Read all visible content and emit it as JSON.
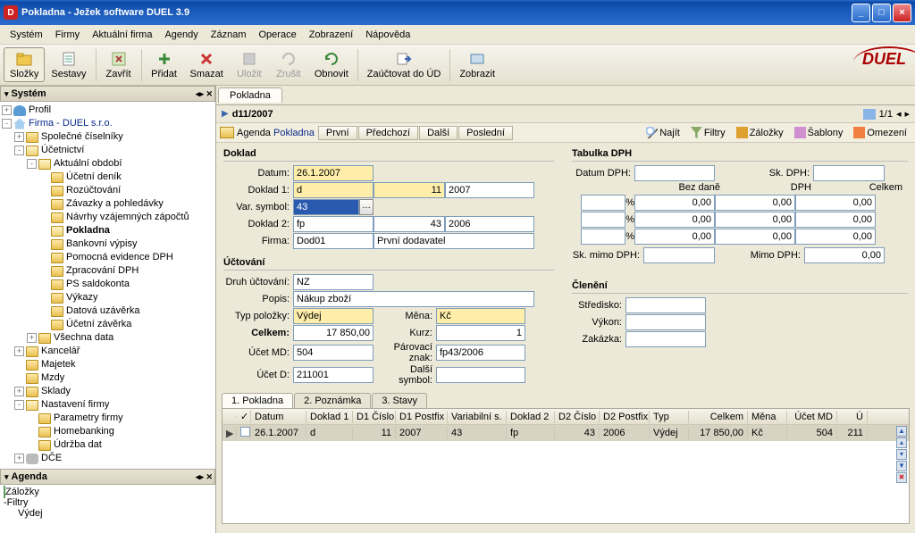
{
  "titlebar": {
    "title": "Pokladna - Ježek software DUEL 3.9",
    "icon_letter": "D"
  },
  "menu": [
    "Systém",
    "Firmy",
    "Aktuální firma",
    "Agendy",
    "Záznam",
    "Operace",
    "Zobrazení",
    "Nápověda"
  ],
  "toolbar": {
    "items": [
      {
        "label": "Složky",
        "active": true
      },
      {
        "label": "Sestavy"
      },
      {
        "sep": true
      },
      {
        "label": "Zavřít"
      },
      {
        "sep": true
      },
      {
        "label": "Přidat"
      },
      {
        "label": "Smazat"
      },
      {
        "label": "Uložit",
        "disabled": true
      },
      {
        "label": "Zrušit",
        "disabled": true
      },
      {
        "label": "Obnovit"
      },
      {
        "sep": true
      },
      {
        "label": "Zaúčtovat do ÚD"
      },
      {
        "sep": true
      },
      {
        "label": "Zobrazit"
      }
    ],
    "logo": "DUEL"
  },
  "left": {
    "system_title": "Systém",
    "agenda_title": "Agenda",
    "tree": {
      "profil": "Profil",
      "firma": "Firma - DUEL s.r.o.",
      "uc": {
        "spolecne": "Společné číselníky",
        "ucetnictvi": "Účetnictví",
        "aktualni": "Aktuální období",
        "leaves": [
          "Účetní deník",
          "Rozúčtování",
          "Závazky a pohledávky",
          "Návrhy vzájemných zápočtů",
          "Pokladna",
          "Bankovní výpisy",
          "Pomocná evidence DPH",
          "Zpracování DPH",
          "PS saldokonta",
          "Výkazy",
          "Datová uzávěrka",
          "Účetní závěrka"
        ],
        "vsechna": "Všechna data"
      },
      "kancelar": "Kancelář",
      "majetek": "Majetek",
      "mzdy": "Mzdy",
      "sklady": "Sklady",
      "nastaveni": "Nastavení firmy",
      "parametry": "Parametry firmy",
      "homebanking": "Homebanking",
      "udrzba": "Údržba dat",
      "dce": "DČE",
      "zalozky": "Záložky",
      "filtry": "Filtry",
      "vydej": "Výdej"
    }
  },
  "content": {
    "tab": "Pokladna",
    "record_id": "d11/2007",
    "pager": "1/1",
    "subnav": {
      "agenda": "Agenda",
      "pokladna": "Pokladna",
      "first": "První",
      "prev": "Předchozí",
      "next": "Další",
      "last": "Poslední"
    },
    "tools": {
      "find": "Najít",
      "filter": "Filtry",
      "bookmark": "Záložky",
      "templates": "Šablony",
      "limit": "Omezení"
    },
    "doklad": {
      "title": "Doklad",
      "datum_l": "Datum:",
      "datum": "26.1.2007",
      "doklad1_l": "Doklad 1:",
      "doklad1_a": "d",
      "doklad1_b": "11",
      "doklad1_c": "2007",
      "vs_l": "Var. symbol:",
      "vs": "43",
      "doklad2_l": "Doklad 2:",
      "doklad2_a": "fp",
      "doklad2_b": "43",
      "doklad2_c": "2006",
      "firma_l": "Firma:",
      "firma_code": "Dod01",
      "firma_name": "První dodavatel"
    },
    "uctovani": {
      "title": "Účtování",
      "druh_l": "Druh účtování:",
      "druh": "NZ",
      "popis_l": "Popis:",
      "popis": "Nákup zboží",
      "typ_l": "Typ položky:",
      "typ": "Výdej",
      "mena_l": "Měna:",
      "mena": "Kč",
      "celkem_l": "Celkem:",
      "celkem": "17 850,00",
      "kurz_l": "Kurz:",
      "kurz": "1",
      "md_l": "Účet MD:",
      "md": "504",
      "par_l": "Párovací znak:",
      "par": "fp43/2006",
      "d_l": "Účet D:",
      "d": "211001",
      "dalsi_l": "Další symbol:",
      "dalsi": ""
    },
    "dph": {
      "title": "Tabulka DPH",
      "datum_l": "Datum DPH:",
      "sk_l": "Sk. DPH:",
      "head": {
        "bez": "Bez daně",
        "dph": "DPH",
        "cel": "Celkem"
      },
      "row_vals": [
        "0,00",
        "0,00",
        "0,00"
      ],
      "pct": "%",
      "mimo_l": "Sk. mimo DPH:",
      "mimodph_l": "Mimo DPH:",
      "mimodph": "0,00"
    },
    "clen": {
      "title": "Členění",
      "str_l": "Středisko:",
      "vyk_l": "Výkon:",
      "zak_l": "Zakázka:"
    },
    "grid": {
      "tabs": [
        "1. Pokladna",
        "2. Poznámka",
        "3. Stavy"
      ],
      "cols": [
        "Datum",
        "Doklad 1",
        "D1 Číslo",
        "D1 Postfix",
        "Variabilní s.",
        "Doklad 2",
        "D2 Číslo",
        "D2 Postfix",
        "Typ",
        "Celkem",
        "Měna",
        "Účet MD",
        "Ú"
      ],
      "row": {
        "datum": "26.1.2007",
        "d1": "d",
        "d1c": "11",
        "d1p": "2007",
        "vs": "43",
        "d2": "fp",
        "d2c": "43",
        "d2p": "2006",
        "typ": "Výdej",
        "cel": "17 850,00",
        "mena": "Kč",
        "md": "504",
        "last": "211"
      }
    }
  }
}
